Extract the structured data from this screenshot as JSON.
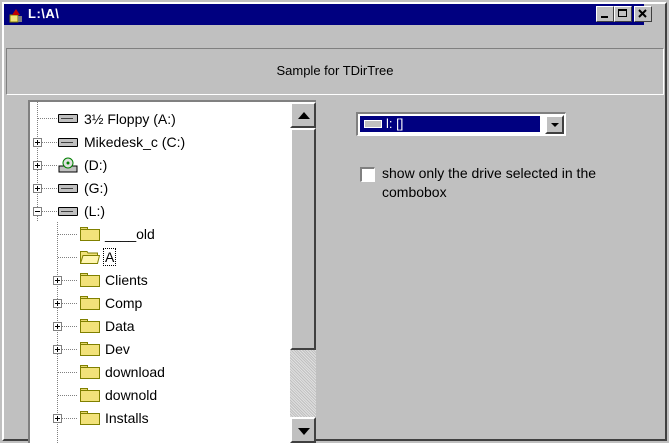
{
  "window": {
    "title": "L:\\A\\",
    "minimize_label": "_",
    "maximize_label": "□",
    "close_label": "×"
  },
  "header": {
    "text": "Sample for TDirTree"
  },
  "tree": {
    "nodes": [
      {
        "label": "3½ Floppy (A:)",
        "type": "drive"
      },
      {
        "label": "Mikedesk_c (C:)",
        "type": "drive"
      },
      {
        "label": "(D:)",
        "type": "cdrom"
      },
      {
        "label": "(G:)",
        "type": "drive"
      },
      {
        "label": "(L:)",
        "type": "drive"
      },
      {
        "label": "____old",
        "type": "folder"
      },
      {
        "label": "A",
        "type": "folder-open"
      },
      {
        "label": "Clients",
        "type": "folder"
      },
      {
        "label": "Comp",
        "type": "folder"
      },
      {
        "label": "Data",
        "type": "folder"
      },
      {
        "label": "Dev",
        "type": "folder"
      },
      {
        "label": "download",
        "type": "folder"
      },
      {
        "label": "downold",
        "type": "folder"
      },
      {
        "label": "Installs",
        "type": "folder"
      }
    ]
  },
  "combo": {
    "selected": "l: []"
  },
  "option": {
    "checked": false,
    "label": "show only the drive selected in the combobox"
  },
  "colors": {
    "titlebar": "#000080",
    "face": "#c0c0c0",
    "folder": "#f2e27a"
  }
}
